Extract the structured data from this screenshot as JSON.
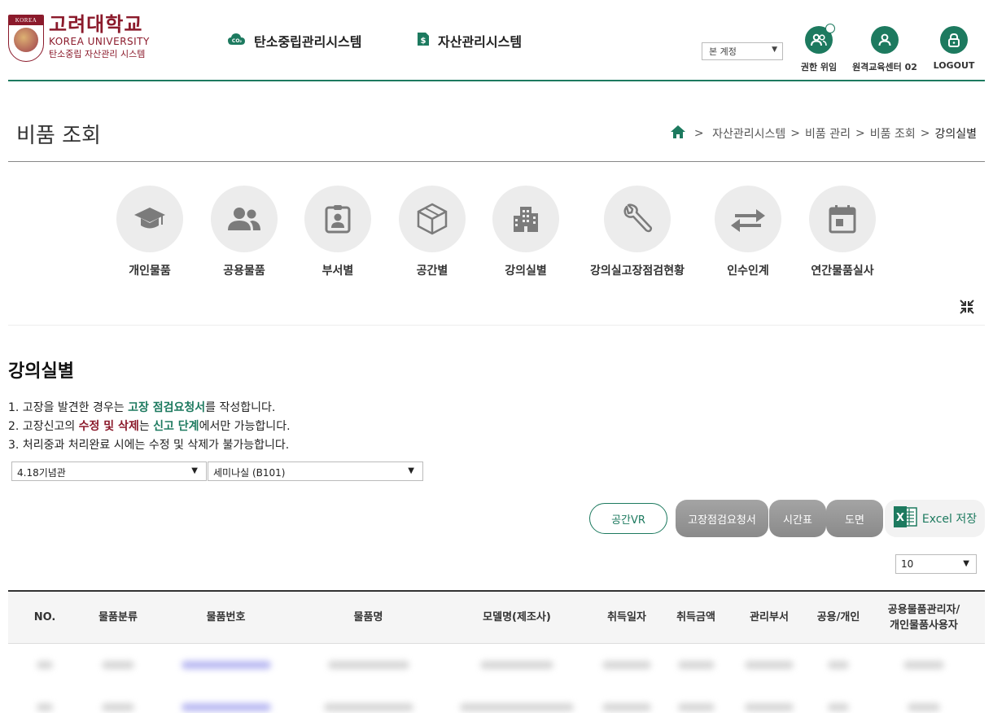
{
  "header": {
    "logo_band": "KOREA",
    "logo_title": "고려대학교",
    "logo_en": "KOREA UNIVERSITY",
    "logo_sub": "탄소중립 자산관리 시스템",
    "nav": [
      {
        "label": "탄소중립관리시스템",
        "icon": "co2-cloud-icon"
      },
      {
        "label": "자산관리시스템",
        "icon": "money-doc-icon"
      }
    ],
    "account_select": "본 계정",
    "utils": [
      {
        "label": "권한 위임",
        "icon": "users-shield-icon"
      },
      {
        "label": "원격교육센터 02",
        "icon": "user-icon"
      },
      {
        "label": "LOGOUT",
        "icon": "lock-icon"
      }
    ]
  },
  "page": {
    "title": "비품 조회",
    "breadcrumb": [
      "자산관리시스템",
      "비품 관리",
      "비품 조회",
      "강의실별"
    ]
  },
  "categories": [
    {
      "label": "개인물품",
      "icon": "graduation-cap-icon"
    },
    {
      "label": "공용물품",
      "icon": "users-icon"
    },
    {
      "label": "부서별",
      "icon": "id-badge-icon"
    },
    {
      "label": "공간별",
      "icon": "cube-icon"
    },
    {
      "label": "강의실별",
      "icon": "building-icon"
    },
    {
      "label": "강의실고장점검현황",
      "icon": "wrench-icon"
    },
    {
      "label": "인수인계",
      "icon": "exchange-icon"
    },
    {
      "label": "연간물품실사",
      "icon": "calendar-icon"
    }
  ],
  "section": {
    "title": "강의실별",
    "notes": [
      {
        "prefix": "1. 고장을 발견한 경우는 ",
        "hl1": "고장 점검요청서",
        "mid": "를 작성합니다.",
        "hl2": "",
        "suffix": ""
      },
      {
        "prefix": "2. 고장신고의 ",
        "hl1": "수정 및 삭제",
        "mid": "는 ",
        "hl2": "신고 단계",
        "suffix": "에서만 가능합니다."
      },
      {
        "prefix": "3. 처리중과 처리완료 시에는 수정 및 삭제가 불가능합니다.",
        "hl1": "",
        "mid": "",
        "hl2": "",
        "suffix": ""
      }
    ],
    "building_select": "4.18기념관",
    "room_select": "세미나실 (B101)",
    "buttons": {
      "vr": "공간VR",
      "repair": "고장점검요청서",
      "timetable": "시간표",
      "floorplan": "도면",
      "excel": "Excel 저장"
    },
    "page_size": "10"
  },
  "table": {
    "columns": [
      "NO.",
      "물품분류",
      "물품번호",
      "물품명",
      "모델명(제조사)",
      "취득일자",
      "취득금액",
      "관리부서",
      "공용/개인",
      "공용물품관리자/\n개인물품사용자"
    ]
  },
  "colors": {
    "accent": "#1d7a5f",
    "brand": "#8b1a2b"
  }
}
